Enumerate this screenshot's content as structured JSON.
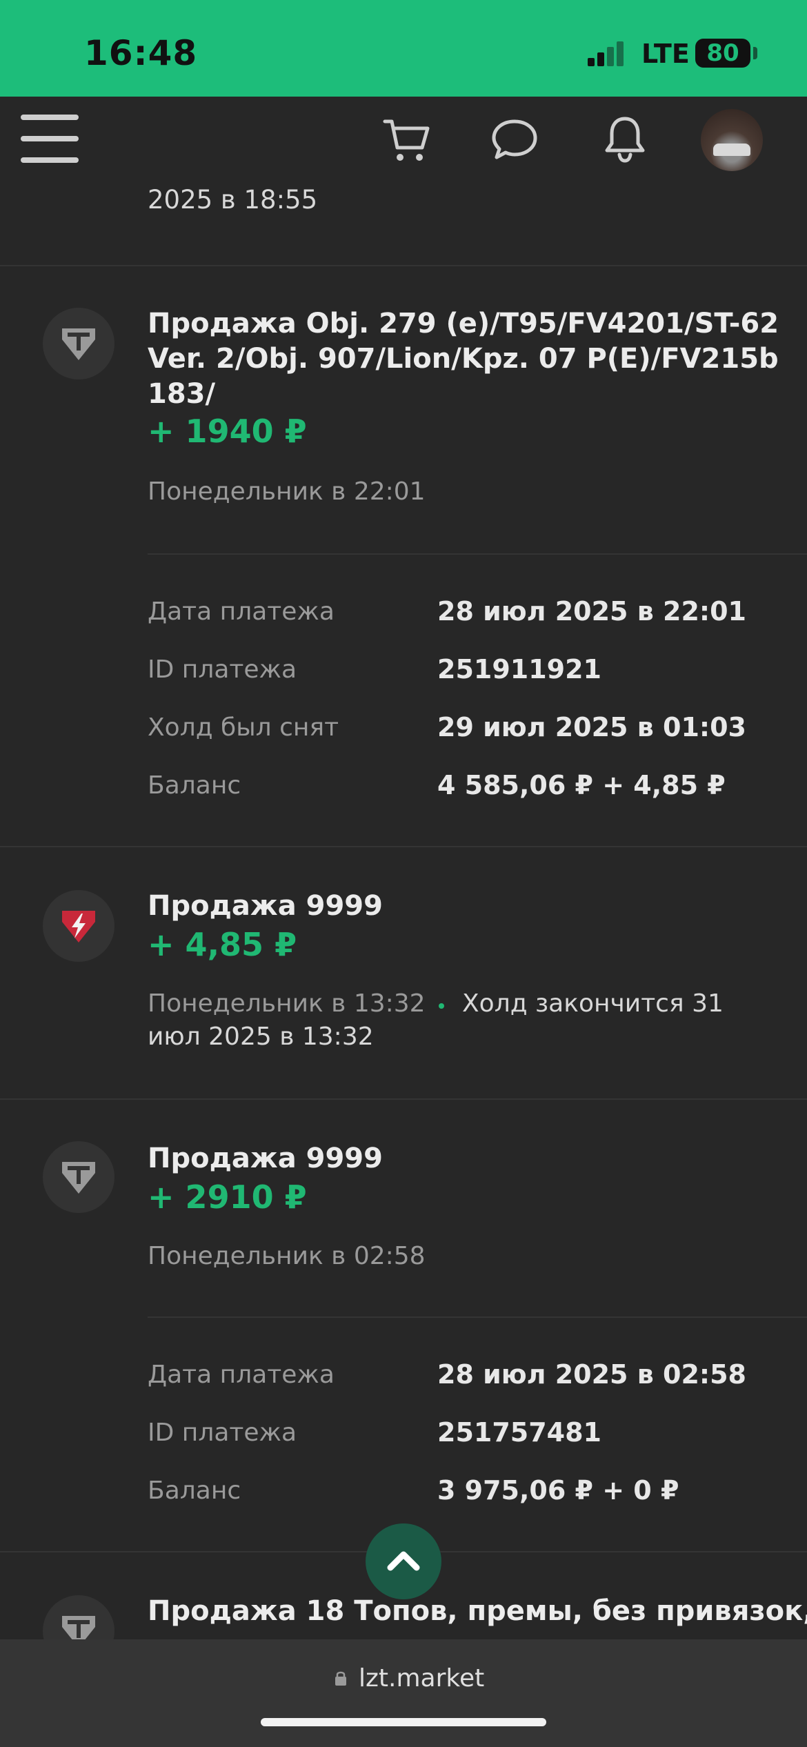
{
  "status_bar": {
    "time": "16:48",
    "network": "LTE",
    "battery": "80"
  },
  "nav": {
    "icons": [
      "menu-icon",
      "cart-icon",
      "chat-icon",
      "bell-icon",
      "avatar"
    ]
  },
  "prev_item": {
    "date_tail": "2025 в 18:55"
  },
  "items": [
    {
      "icon": "wot-icon",
      "title_lines": [
        "Продажа Obj. 279 (e)/T95/FV4201/ST-62",
        "Ver. 2/Obj. 907/Lion/Kpz. 07 P(E)/FV215b",
        "183/"
      ],
      "amount": "+ 1940 ₽",
      "time": "Понедельник в 22:01",
      "details": [
        {
          "label": "Дата платежа",
          "value": "28 июл 2025 в 22:01"
        },
        {
          "label": "ID платежа",
          "value": "251911921"
        },
        {
          "label": "Холд был снят",
          "value": "29 июл 2025 в 01:03"
        },
        {
          "label": "Баланс",
          "value": "4 585,06 ₽ + 4,85 ₽"
        }
      ]
    },
    {
      "icon": "lightning-badge-icon",
      "title": "Продажа 9999",
      "amount": "+ 4,85 ₽",
      "time": "Понедельник в 13:32",
      "hold_line1": "Холд закончится 31",
      "hold_line2": "июл 2025 в 13:32"
    },
    {
      "icon": "wot-icon",
      "title": "Продажа 9999",
      "amount": "+ 2910 ₽",
      "time": "Понедельник в 02:58",
      "details": [
        {
          "label": "Дата платежа",
          "value": "28 июл 2025 в 02:58"
        },
        {
          "label": "ID платежа",
          "value": "251757481"
        },
        {
          "label": "Баланс",
          "value": "3 975,06 ₽ + 0 ₽"
        }
      ]
    },
    {
      "icon": "wot-icon",
      "title": "Продажа 18 Топов, премы, без привязок,"
    }
  ],
  "browser": {
    "url": "lzt.market"
  },
  "colors": {
    "accent": "#1dbd7a",
    "amount": "#20b873",
    "background": "#272727"
  }
}
